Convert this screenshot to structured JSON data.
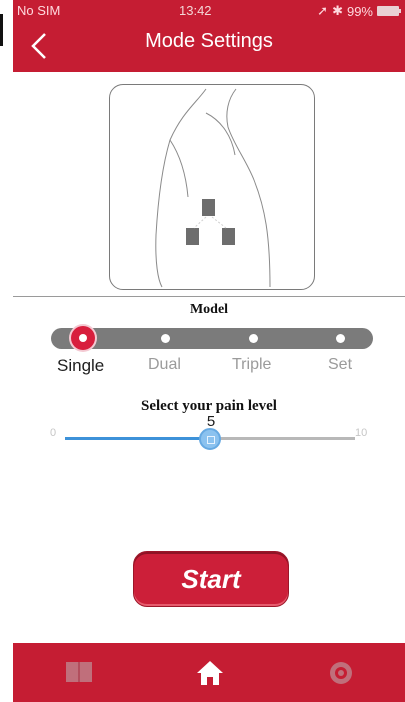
{
  "status_bar": {
    "carrier": "No SIM",
    "time": "13:42",
    "battery": "99%",
    "icons": [
      "location-arrow-icon",
      "bluetooth-icon",
      "battery-icon"
    ]
  },
  "header": {
    "title": "Mode Settings",
    "back_icon": "chevron-left-icon"
  },
  "placement": {
    "illustration": "body-outline-illustration",
    "electrodes": [
      "electrode-pad",
      "electrode-pad",
      "electrode-pad"
    ]
  },
  "model": {
    "label": "Model",
    "options": [
      "Single",
      "Dual",
      "Triple",
      "Set"
    ],
    "selected": "Single"
  },
  "pain": {
    "label": "Select your pain level",
    "min": "0",
    "max": "10",
    "value": "5"
  },
  "actions": {
    "start_label": "Start"
  },
  "tabbar": {
    "items": [
      "book-icon",
      "home-icon",
      "settings-icon"
    ]
  },
  "colors": {
    "primary": "#c51d33",
    "accent_blue": "#3d92d9",
    "track_gray": "#7b7b7b"
  }
}
